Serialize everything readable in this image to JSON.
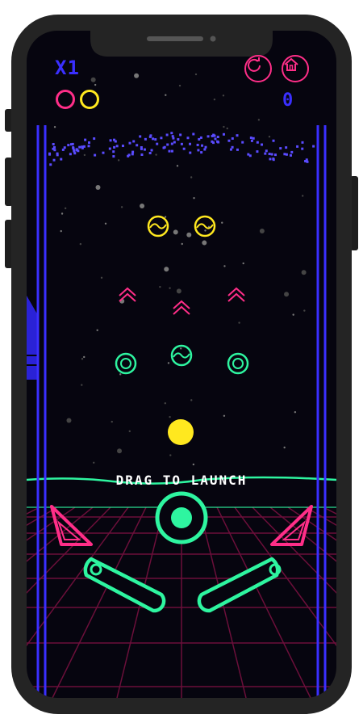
{
  "hud": {
    "multiplier": "X1",
    "score": "0",
    "balls_remaining": [
      {
        "icon": "ball-outline-icon",
        "color": "#ff2e88"
      },
      {
        "icon": "ball-outline-icon",
        "color": "#ffe81f"
      }
    ],
    "restart_icon": "restart-icon",
    "home_icon": "home-icon"
  },
  "launch_prompt": "DRAG TO LAUNCH",
  "colors": {
    "background": "#06050f",
    "rail": "#3a2fff",
    "neon_green": "#2ef5a0",
    "neon_pink": "#ff2e88",
    "neon_yellow": "#ffe81f",
    "score_blue": "#3a2fff",
    "grid": "#6b0f3a"
  },
  "board": {
    "bumpers_yellow": 2,
    "bumpers_green": 3,
    "chevron_targets": 3,
    "ball_color": "#ffe81f"
  }
}
